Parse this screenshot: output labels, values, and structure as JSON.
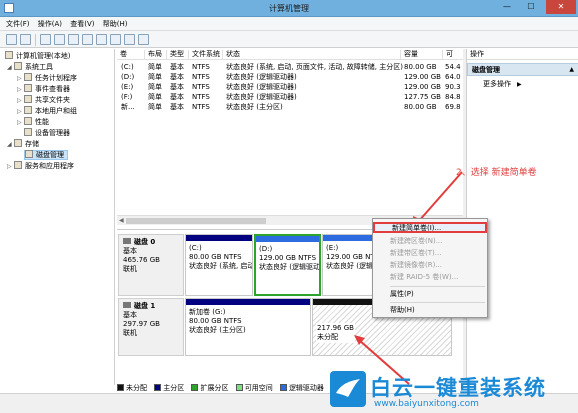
{
  "window": {
    "title": "计算机管理",
    "min": "—",
    "max": "☐",
    "close": "✕"
  },
  "menu": [
    "文件(F)",
    "操作(A)",
    "查看(V)",
    "帮助(H)"
  ],
  "tree": {
    "root": "计算机管理(本地)",
    "system_tools": "系统工具",
    "items": [
      "任务计划程序",
      "事件查看器",
      "共享文件夹",
      "本地用户和组",
      "性能",
      "设备管理器"
    ],
    "storage": "存储",
    "disk_mgmt": "磁盘管理",
    "services": "服务和应用程序"
  },
  "list": {
    "columns": [
      "卷",
      "布局",
      "类型",
      "文件系统",
      "状态",
      "容量",
      "可"
    ],
    "rows": [
      {
        "vol": "(C:)",
        "layout": "简单",
        "type": "基本",
        "fs": "NTFS",
        "status": "状态良好 (系统, 启动, 页面文件, 活动, 故障转储, 主分区)",
        "cap": "80.00 GB",
        "free": "54.4"
      },
      {
        "vol": "(D:)",
        "layout": "简单",
        "type": "基本",
        "fs": "NTFS",
        "status": "状态良好 (逻辑驱动器)",
        "cap": "129.00 GB",
        "free": "64.0"
      },
      {
        "vol": "(E:)",
        "layout": "简单",
        "type": "基本",
        "fs": "NTFS",
        "status": "状态良好 (逻辑驱动器)",
        "cap": "129.00 GB",
        "free": "90.3"
      },
      {
        "vol": "(F:)",
        "layout": "简单",
        "type": "基本",
        "fs": "NTFS",
        "status": "状态良好 (逻辑驱动器)",
        "cap": "127.75 GB",
        "free": "84.8"
      },
      {
        "vol": "新...",
        "layout": "简单",
        "type": "基本",
        "fs": "NTFS",
        "status": "状态良好 (主分区)",
        "cap": "80.00 GB",
        "free": "69.8"
      }
    ]
  },
  "disks": [
    {
      "name": "磁盘 0",
      "type": "基本",
      "size": "465.76 GB",
      "state": "联机",
      "parts": [
        {
          "label": "(C:)",
          "size": "80.00 GB NTFS",
          "status": "状态良好 (系统, 启动"
        },
        {
          "label": "(D:)",
          "size": "129.00 GB NTFS",
          "status": "状态良好 (逻辑驱动器"
        },
        {
          "label": "(E:)",
          "size": "129.00 GB NTFS",
          "status": "状态良好 (逻辑驱动器"
        }
      ]
    },
    {
      "name": "磁盘 1",
      "type": "基本",
      "size": "297.97 GB",
      "state": "联机",
      "parts": [
        {
          "label": "新加卷 (G:)",
          "size": "80.00 GB NTFS",
          "status": "状态良好 (主分区)"
        },
        {
          "label": "",
          "size": "217.96 GB",
          "status": "未分配"
        }
      ]
    }
  ],
  "legend": [
    {
      "label": "未分配",
      "color": "#111111"
    },
    {
      "label": "主分区",
      "color": "#000080"
    },
    {
      "label": "扩展分区",
      "color": "#2da52d"
    },
    {
      "label": "可用空间",
      "color": "#7fe07f"
    },
    {
      "label": "逻辑驱动器",
      "color": "#2d6be0"
    }
  ],
  "actions": {
    "header": "操作",
    "section": "磁盘管理",
    "more": "更多操作"
  },
  "context_menu": [
    {
      "label": "新建简单卷(I)...",
      "enabled": true
    },
    {
      "label": "新建跨区卷(N)...",
      "enabled": false
    },
    {
      "label": "新建带区卷(T)...",
      "enabled": false
    },
    {
      "label": "新建镜像卷(R)...",
      "enabled": false
    },
    {
      "label": "新建 RAID-5 卷(W)...",
      "enabled": false
    },
    {
      "label": "属性(P)",
      "enabled": true
    },
    {
      "label": "帮助(H)",
      "enabled": true
    }
  ],
  "annotation": "2、选择 新建简单卷",
  "watermark": {
    "brand": "白云一键重装系统",
    "url": "www.baiyunxitong.com"
  },
  "colors": {
    "annotation": "#e23c3c",
    "primary": "#000080",
    "logical": "#2d6be0",
    "extended": "#2da52d"
  }
}
